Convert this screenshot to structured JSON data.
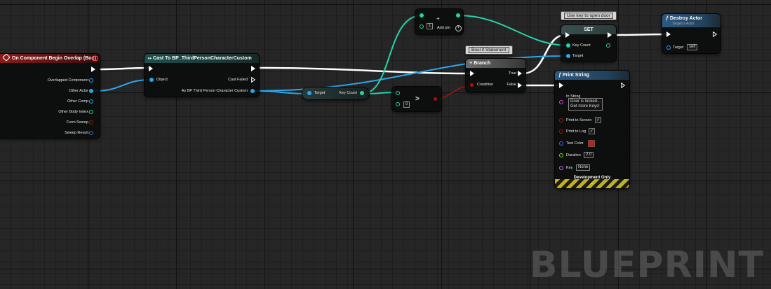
{
  "app": {
    "watermark": "BLUEPRINT"
  },
  "nodes": {
    "overlap": {
      "title": "On Component Begin Overlap (Box)",
      "outputs": [
        "Overlapped Component",
        "Other Actor",
        "Other Comp",
        "Other Body Index",
        "From Sweep",
        "Sweep Result"
      ]
    },
    "cast": {
      "title": "Cast To BP_ThirdPersonCharacterCustom",
      "object": "Object",
      "cast_failed": "Cast Failed",
      "as_output": "As BP Third Person Character Custom"
    },
    "getter": {
      "target": "Target",
      "key_count": "Key Count"
    },
    "add": {
      "title": "+",
      "input_value": "1",
      "add_pin": "Add pin"
    },
    "compare": {
      "op": ">",
      "input_value": "0"
    },
    "branch": {
      "comment": "Bool if Statement",
      "title": "Branch",
      "condition": "Condition",
      "true_label": "True",
      "false_label": "False"
    },
    "set": {
      "comment": "Use key to open door",
      "title": "SET",
      "key_count": "Key Count",
      "target": "Target"
    },
    "destroy": {
      "title": "Destroy Actor",
      "subtitle": "Target is Actor",
      "target": "Target",
      "target_value": "self"
    },
    "print": {
      "title": "Print String",
      "in_string_label": "In String",
      "in_string_line1": "Door is locked...",
      "in_string_line2": "Get more Keys!",
      "print_to_screen": "Print to Screen",
      "print_to_log": "Print to Log",
      "text_color": "Text Color",
      "text_color_value": "#e01010",
      "duration": "Duration",
      "duration_value": "2.0",
      "key": "Key",
      "key_value": "None",
      "dev_only": "Development Only",
      "check_mark": "✓"
    }
  },
  "colors": {
    "exec_wire": "#ffffff",
    "object_wire": "#2aa6ea",
    "int_wire": "#22d5a8",
    "bool_wire": "#a41212",
    "event_header": "#8e1b1b"
  }
}
